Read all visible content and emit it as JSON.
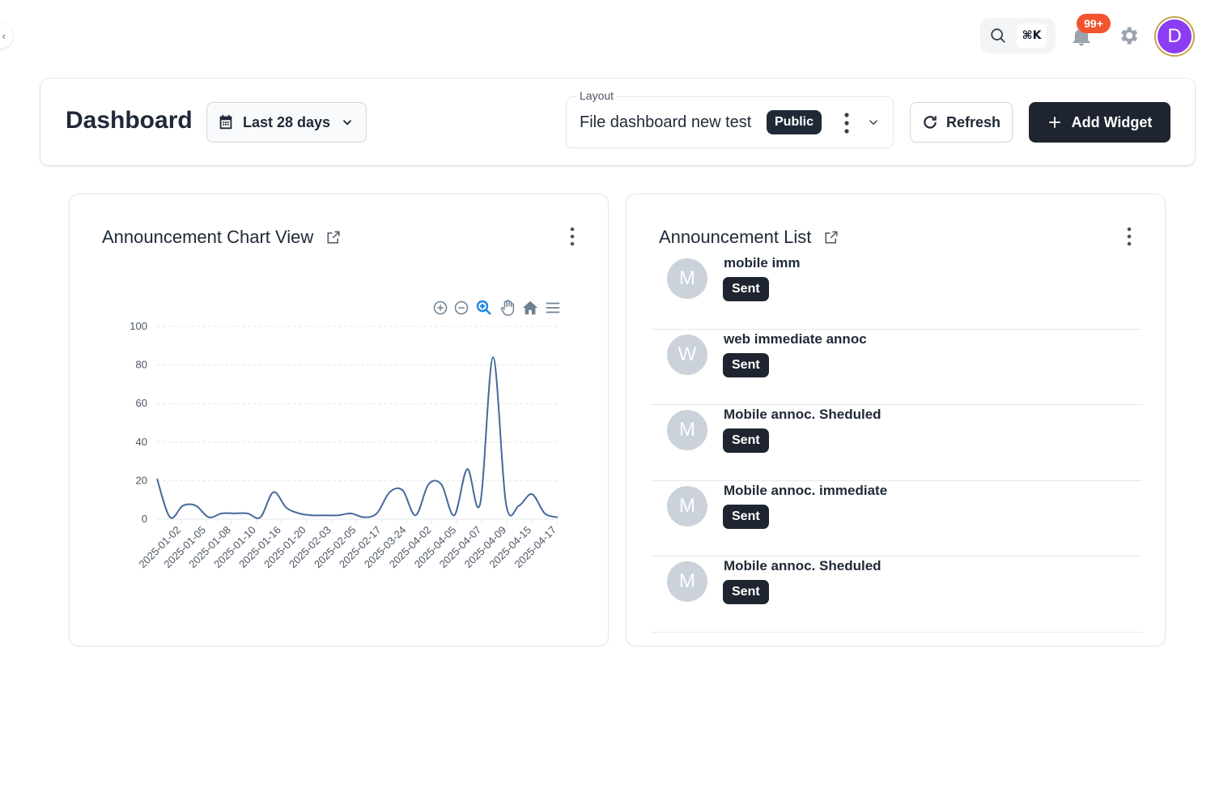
{
  "topbar": {
    "search_shortcut": "⌘K",
    "notifications_count": "99+",
    "avatar_initial": "D"
  },
  "header": {
    "title": "Dashboard",
    "date_range": "Last 28 days",
    "layout_label": "Layout",
    "layout_value": "File dashboard new test",
    "layout_visibility": "Public",
    "refresh_label": "Refresh",
    "add_widget_label": "Add Widget"
  },
  "chart_widget": {
    "title": "Announcement Chart View"
  },
  "list_widget": {
    "title": "Announcement List",
    "items": [
      {
        "initial": "M",
        "title": "mobile imm",
        "status": "Sent"
      },
      {
        "initial": "W",
        "title": "web immediate annoc",
        "status": "Sent"
      },
      {
        "initial": "M",
        "title": "Mobile annoc. Sheduled",
        "status": "Sent"
      },
      {
        "initial": "M",
        "title": "Mobile annoc. immediate",
        "status": "Sent"
      },
      {
        "initial": "M",
        "title": "Mobile annoc. Sheduled",
        "status": "Sent"
      }
    ]
  },
  "colors": {
    "primary_dark": "#1f2530",
    "badge_red": "#f2542d",
    "avatar_purple": "#8b3df2",
    "line": "#46699b",
    "zoom_active": "#1e88e5"
  },
  "chart_data": {
    "type": "line",
    "title": "",
    "xlabel": "",
    "ylabel": "",
    "ylim": [
      0,
      100
    ],
    "yticks": [
      0,
      20,
      40,
      60,
      80,
      100
    ],
    "grid": true,
    "x_tick_labels": [
      "2025-01-02",
      "2025-01-05",
      "2025-01-08",
      "2025-01-10",
      "2025-01-16",
      "2025-01-20",
      "2025-02-03",
      "2025-02-05",
      "2025-02-17",
      "2025-03-24",
      "2025-04-02",
      "2025-04-05",
      "2025-04-07",
      "2025-04-09",
      "2025-04-15",
      "2025-04-17"
    ],
    "series": [
      {
        "values": [
          21,
          1,
          7,
          7,
          1,
          3,
          3,
          3,
          1,
          14,
          6,
          3,
          2,
          2,
          2,
          3,
          1,
          3,
          14,
          15,
          2,
          18,
          18,
          2,
          26,
          8,
          84,
          8,
          7,
          13,
          3,
          1
        ]
      }
    ]
  }
}
